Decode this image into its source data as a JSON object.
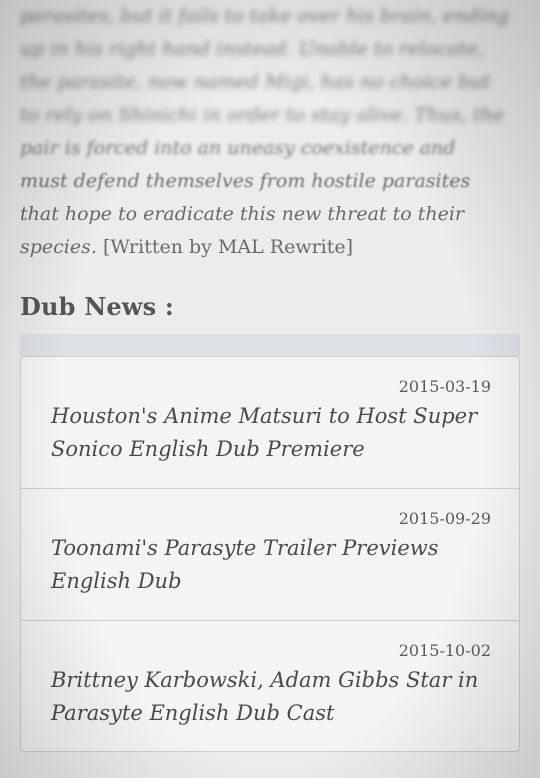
{
  "synopsis": {
    "lines": [
      "parasites, but it fails to take over his brain, ending",
      "up in his right hand instead. Unable to relocate,",
      "the parasite, now named Migi, has no choice but",
      "to rely on Shinichi in order to stay alive. Thus, the",
      "pair is forced into an uneasy coexistence and",
      "must defend themselves from hostile parasites",
      "that hope to eradicate this new threat to their"
    ],
    "last_line": "species.",
    "credit": "[Written by MAL Rewrite]"
  },
  "dub_news": {
    "heading": "Dub News :",
    "items": [
      {
        "date": "2015-03-19",
        "title": "Houston's Anime Matsuri to Host Super Sonico English Dub Premiere"
      },
      {
        "date": "2015-09-29",
        "title": "Toonami's Parasyte Trailer Previews English Dub"
      },
      {
        "date": "2015-10-02",
        "title": "Brittney Karbowski, Adam Gibbs Star in Parasyte English Dub Cast"
      }
    ]
  }
}
